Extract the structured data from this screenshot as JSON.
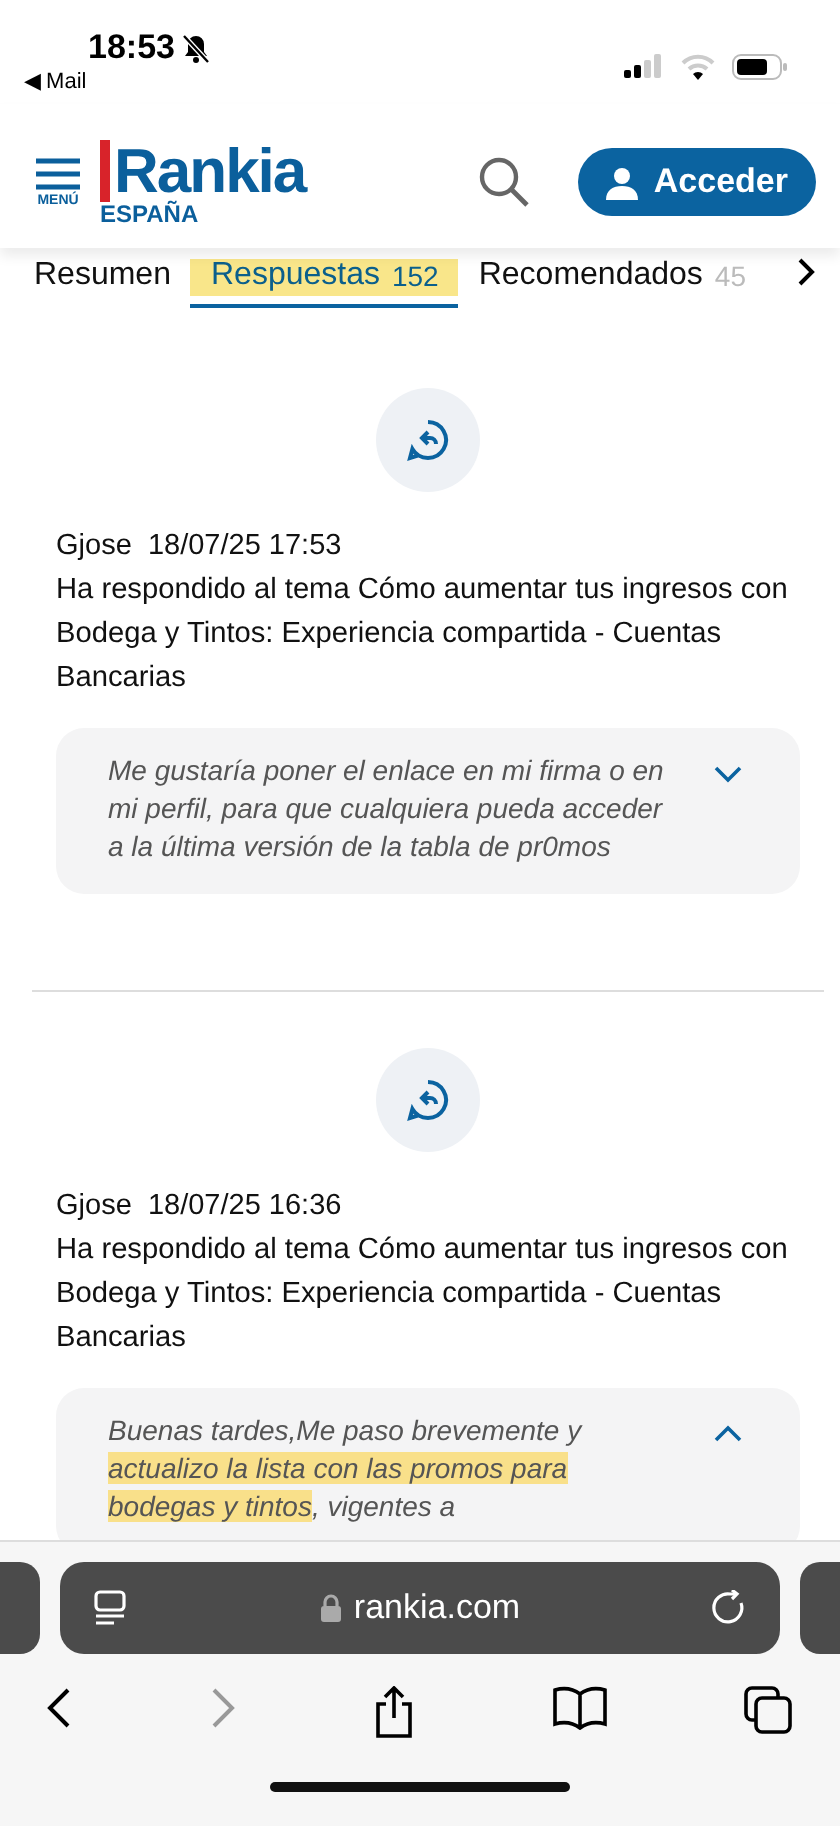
{
  "status_bar": {
    "time": "18:53",
    "back_app": "◀ Mail"
  },
  "header": {
    "menu_label": "MENÚ",
    "logo": "Rankia",
    "logo_region": "ESPAÑA",
    "login_button": "Acceder"
  },
  "tabs": [
    {
      "label": "Resumen",
      "selected": false,
      "highlighted": false
    },
    {
      "label": "Respuestas",
      "count": "152",
      "selected": true,
      "highlighted": true
    },
    {
      "label": "Recomendados",
      "count": "45",
      "selected": false,
      "highlighted": false
    }
  ],
  "replies": [
    {
      "author": "Gjose",
      "date": "18/07/25 17:53",
      "text": "Ha respondido al tema Cómo aumentar tus ingresos con Bodega y Tintos: Experiencia compartida - Cuentas Bancarias",
      "expanded": false,
      "quote": [
        {
          "text": "Me gustaría poner el enlace en mi firma o en mi perfil, para que cualquiera pueda acceder a la última versión de la tabla de pr0mos",
          "highlighted": false
        }
      ]
    },
    {
      "author": "Gjose",
      "date": "18/07/25 16:36",
      "text": "Ha respondido al tema Cómo aumentar tus ingresos con Bodega y Tintos: Experiencia compartida - Cuentas Bancarias",
      "expanded": true,
      "quote": [
        {
          "text": "Buenas tardes,Me paso brevemente y ",
          "highlighted": false
        },
        {
          "text": "actualizo la lista con las promos para bodegas y tintos",
          "highlighted": true
        },
        {
          "text": ", vigentes a",
          "highlighted": false
        }
      ]
    }
  ],
  "browser": {
    "address": "rankia.com",
    "forward_disabled": true
  }
}
